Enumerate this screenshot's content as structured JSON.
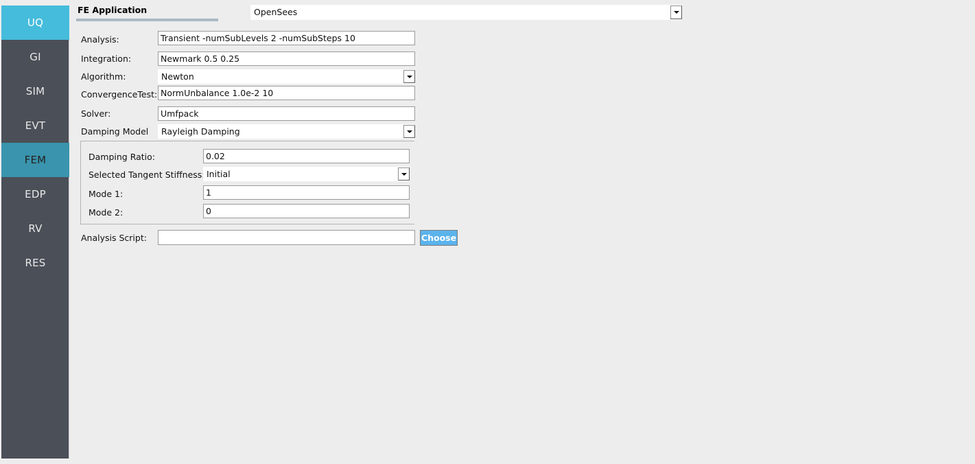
{
  "sidebar": {
    "items": [
      {
        "label": "UQ",
        "state": "active-primary"
      },
      {
        "label": "GI",
        "state": "normal"
      },
      {
        "label": "SIM",
        "state": "normal"
      },
      {
        "label": "EVT",
        "state": "normal"
      },
      {
        "label": "FEM",
        "state": "active-secondary"
      },
      {
        "label": "EDP",
        "state": "normal"
      },
      {
        "label": "RV",
        "state": "normal"
      },
      {
        "label": "RES",
        "state": "normal"
      }
    ],
    "colors": {
      "background": "#4b4f58",
      "active_primary": "#45bcdc",
      "active_secondary": "#3a94ad"
    }
  },
  "header": {
    "title": "FE Application",
    "application_selected": "OpenSees"
  },
  "form": {
    "analysis": {
      "label": "Analysis:",
      "value": "Transient -numSubLevels 2 -numSubSteps 10"
    },
    "integration": {
      "label": "Integration:",
      "value": "Newmark 0.5 0.25"
    },
    "algorithm": {
      "label": "Algorithm:",
      "value": "Newton"
    },
    "convergence_test": {
      "label": "ConvergenceTest:",
      "value": "NormUnbalance 1.0e-2 10"
    },
    "solver": {
      "label": "Solver:",
      "value": "Umfpack"
    },
    "damping_model": {
      "label": "Damping Model",
      "value": "Rayleigh Damping"
    },
    "analysis_script": {
      "label": "Analysis Script:",
      "value": "",
      "placeholder": ""
    },
    "choose_button": "Choose"
  },
  "damping_group": {
    "damping_ratio": {
      "label": "Damping Ratio:",
      "value": "0.02"
    },
    "tangent_stiffness": {
      "label": "Selected Tangent Stiffness:",
      "value": "Initial"
    },
    "mode_1": {
      "label": "Mode 1:",
      "value": "1"
    },
    "mode_2": {
      "label": "Mode 2:",
      "value": "0"
    }
  },
  "icons": {
    "dropdown": "chevron-down-icon"
  }
}
